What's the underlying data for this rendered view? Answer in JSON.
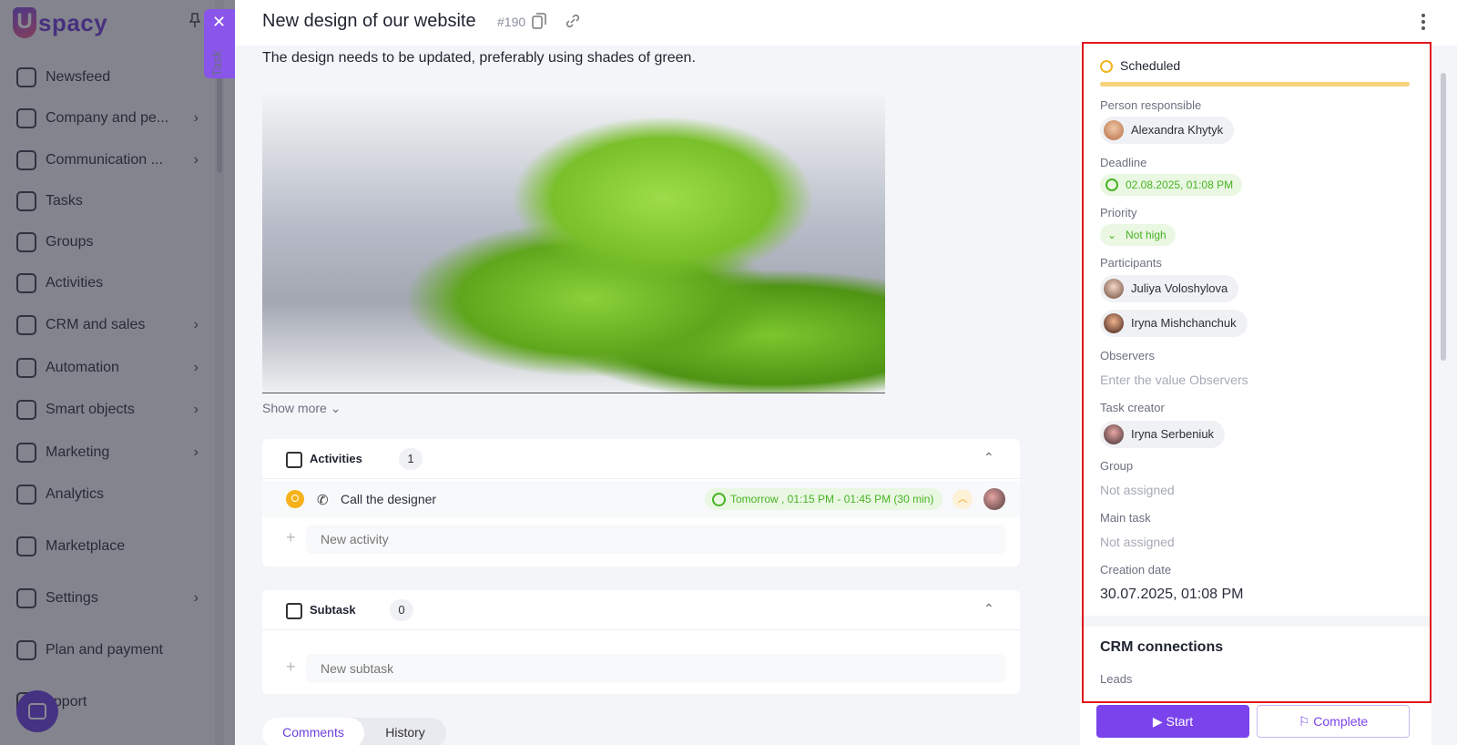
{
  "sidebar": {
    "logo_text": "spacy",
    "items": [
      {
        "label": "Newsfeed",
        "icon": "home-icon",
        "has_arrow": false
      },
      {
        "label": "Company and pe...",
        "icon": "building-icon",
        "has_arrow": true
      },
      {
        "label": "Communication ...",
        "icon": "chat-icon",
        "has_arrow": true
      },
      {
        "label": "Tasks",
        "icon": "check-circle-icon",
        "has_arrow": false
      },
      {
        "label": "Groups",
        "icon": "users-icon",
        "has_arrow": false
      },
      {
        "label": "Activities",
        "icon": "calendar-icon",
        "has_arrow": false
      },
      {
        "label": "CRM and sales",
        "icon": "crm-icon",
        "has_arrow": true
      },
      {
        "label": "Automation",
        "icon": "lightning-icon",
        "has_arrow": true
      },
      {
        "label": "Smart objects",
        "icon": "smart-object-icon",
        "has_arrow": true
      },
      {
        "label": "Marketing",
        "icon": "megaphone-icon",
        "has_arrow": true
      },
      {
        "label": "Analytics",
        "icon": "chart-icon",
        "has_arrow": false
      },
      {
        "label": "Marketplace",
        "icon": "store-icon",
        "has_arrow": false
      },
      {
        "label": "Settings",
        "icon": "gear-icon",
        "has_arrow": true
      },
      {
        "label": "Plan and payment",
        "icon": "wallet-icon",
        "has_arrow": false
      },
      {
        "label": "upport",
        "icon": "support-icon",
        "has_arrow": false
      }
    ]
  },
  "task_tab": {
    "label": "Task"
  },
  "header": {
    "title": "New design of our website",
    "task_number": "#190"
  },
  "description": "The design needs to be updated, preferably using shades of green.",
  "show_more": "Show more",
  "activities": {
    "title": "Activities",
    "count": "1",
    "items": [
      {
        "title": "Call the designer",
        "time": "Tomorrow , 01:15 PM - 01:45 PM (30 min)"
      }
    ],
    "new_placeholder": "New activity"
  },
  "subtask": {
    "title": "Subtask",
    "count": "0",
    "new_placeholder": "New subtask"
  },
  "tabs": {
    "comments": "Comments",
    "history": "History"
  },
  "details": {
    "status": "Scheduled",
    "status_color": "#f1b521",
    "person_responsible_label": "Person responsible",
    "person_responsible": "Alexandra Khytyk",
    "deadline_label": "Deadline",
    "deadline": "02.08.2025, 01:08 PM",
    "priority_label": "Priority",
    "priority": "Not high",
    "participants_label": "Participants",
    "participants": [
      "Juliya Voloshylova",
      "Iryna Mishchanchuk"
    ],
    "observers_label": "Observers",
    "observers_placeholder": "Enter the value Observers",
    "task_creator_label": "Task creator",
    "task_creator": "Iryna Serbeniuk",
    "group_label": "Group",
    "group_value": "Not assigned",
    "main_task_label": "Main task",
    "main_task_value": "Not assigned",
    "creation_date_label": "Creation date",
    "creation_date": "30.07.2025, 01:08 PM",
    "crm_title": "CRM connections",
    "leads_label": "Leads"
  },
  "actions": {
    "start": "Start",
    "complete": "Complete"
  },
  "colors": {
    "accent": "#7a43ec",
    "success": "#47b423",
    "highlight": "#e3161c"
  }
}
